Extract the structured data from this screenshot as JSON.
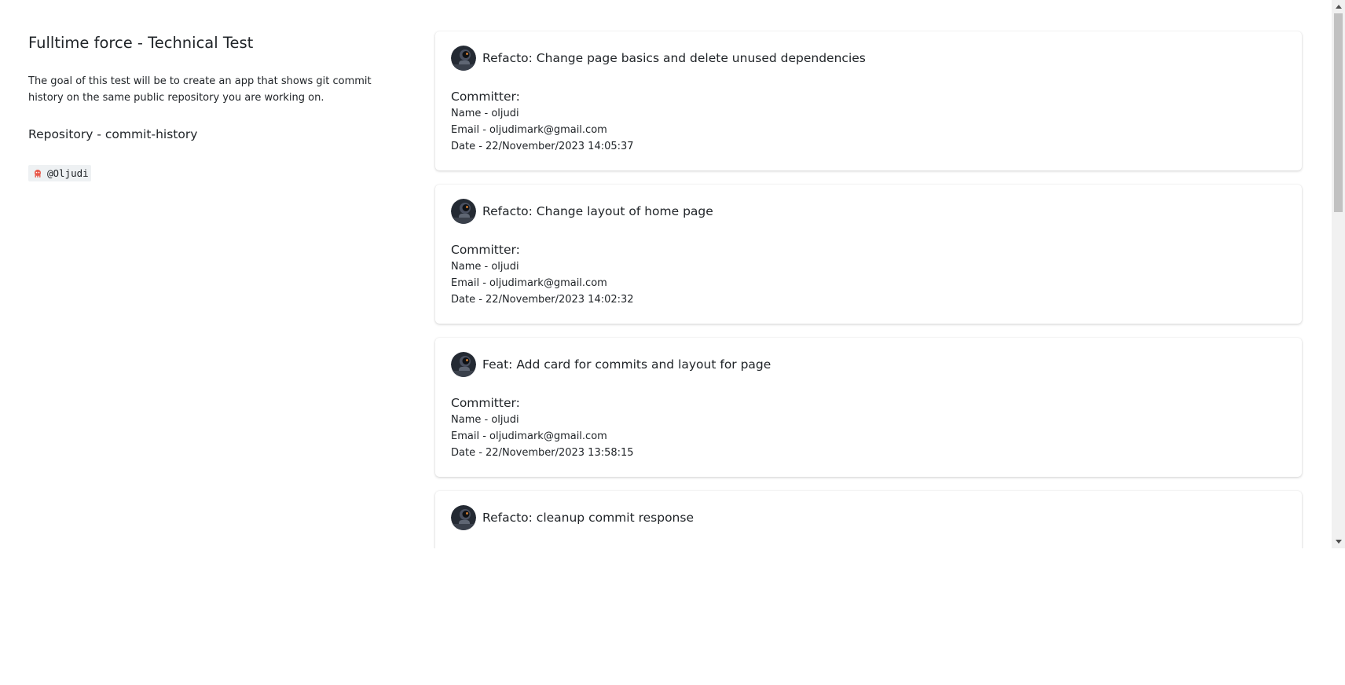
{
  "intro": {
    "title": "Fulltime force - Technical Test",
    "description": "The goal of this test will be to create an app that shows git commit history on the same public repository you are working on.",
    "repository_label": "Repository",
    "repository_separator": "-",
    "repository_name": "commit-history",
    "user_handle": "@Oljudi"
  },
  "commit_labels": {
    "committer_heading": "Committer:",
    "name_prefix": "Name - ",
    "email_prefix": "Email - ",
    "date_prefix": "Date - "
  },
  "commits": [
    {
      "message": "Refacto: Change page basics and delete unused dependencies",
      "name": "oljudi",
      "email": "oljudimark@gmail.com",
      "date": "22/November/2023 14:05:37"
    },
    {
      "message": "Refacto: Change layout of home page",
      "name": "oljudi",
      "email": "oljudimark@gmail.com",
      "date": "22/November/2023 14:02:32"
    },
    {
      "message": "Feat: Add card for commits and layout for page",
      "name": "oljudi",
      "email": "oljudimark@gmail.com",
      "date": "22/November/2023 13:58:15"
    },
    {
      "message": "Refacto: cleanup commit response",
      "name": "",
      "email": "",
      "date": ""
    }
  ],
  "icons": {
    "user_badge_icon": "github-octocat-icon",
    "avatar": "astronaut-avatar"
  },
  "colors": {
    "text": "#212529",
    "badge_background": "#eef1f3",
    "badge_icon": "#e8594b",
    "scrollbar_track": "#f1f1f1",
    "scrollbar_thumb": "#c1c1c1"
  }
}
